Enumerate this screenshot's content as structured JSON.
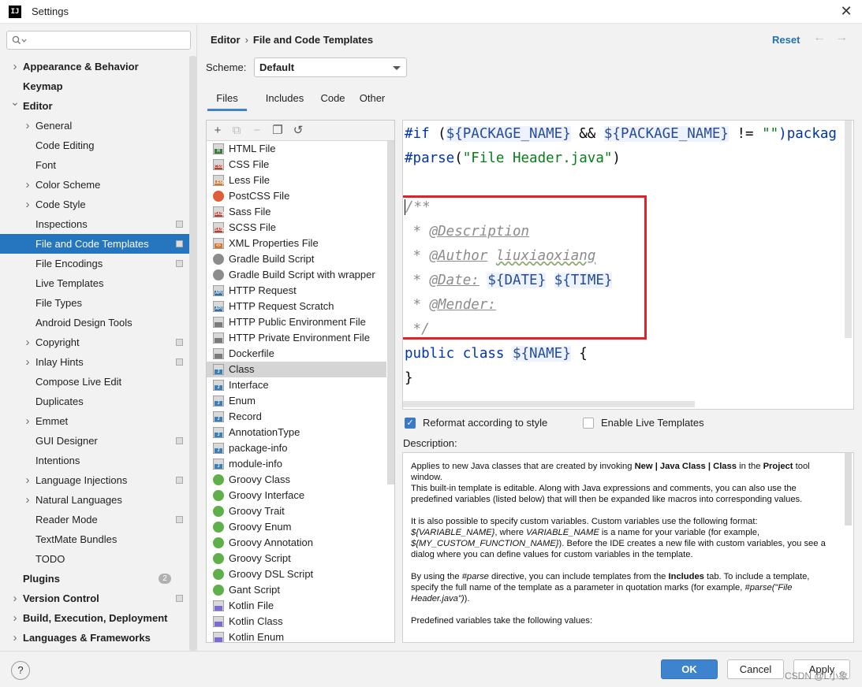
{
  "window": {
    "title": "Settings",
    "app_icon_text": "IJ",
    "close_glyph": "✕"
  },
  "sidebar": {
    "search_placeholder": "",
    "items": [
      {
        "label": "Appearance & Behavior",
        "level": 0,
        "bold": true,
        "expandable": true,
        "expanded": false
      },
      {
        "label": "Keymap",
        "level": 0,
        "bold": true
      },
      {
        "label": "Editor",
        "level": 0,
        "bold": true,
        "expandable": true,
        "expanded": true
      },
      {
        "label": "General",
        "level": 1,
        "expandable": true
      },
      {
        "label": "Code Editing",
        "level": 1
      },
      {
        "label": "Font",
        "level": 1
      },
      {
        "label": "Color Scheme",
        "level": 1,
        "expandable": true
      },
      {
        "label": "Code Style",
        "level": 1,
        "expandable": true
      },
      {
        "label": "Inspections",
        "level": 1,
        "tag": true
      },
      {
        "label": "File and Code Templates",
        "level": 1,
        "selected": true,
        "tag": true
      },
      {
        "label": "File Encodings",
        "level": 1,
        "tag": true
      },
      {
        "label": "Live Templates",
        "level": 1
      },
      {
        "label": "File Types",
        "level": 1
      },
      {
        "label": "Android Design Tools",
        "level": 1
      },
      {
        "label": "Copyright",
        "level": 1,
        "expandable": true,
        "tag": true
      },
      {
        "label": "Inlay Hints",
        "level": 1,
        "expandable": true,
        "tag": true
      },
      {
        "label": "Compose Live Edit",
        "level": 1
      },
      {
        "label": "Duplicates",
        "level": 1
      },
      {
        "label": "Emmet",
        "level": 1,
        "expandable": true
      },
      {
        "label": "GUI Designer",
        "level": 1,
        "tag": true
      },
      {
        "label": "Intentions",
        "level": 1
      },
      {
        "label": "Language Injections",
        "level": 1,
        "expandable": true,
        "tag": true
      },
      {
        "label": "Natural Languages",
        "level": 1,
        "expandable": true
      },
      {
        "label": "Reader Mode",
        "level": 1,
        "tag": true
      },
      {
        "label": "TextMate Bundles",
        "level": 1
      },
      {
        "label": "TODO",
        "level": 1
      },
      {
        "label": "Plugins",
        "level": 0,
        "bold": true,
        "badge": "2"
      },
      {
        "label": "Version Control",
        "level": 0,
        "bold": true,
        "expandable": true,
        "tag": true
      },
      {
        "label": "Build, Execution, Deployment",
        "level": 0,
        "bold": true,
        "expandable": true
      },
      {
        "label": "Languages & Frameworks",
        "level": 0,
        "bold": true,
        "expandable": true
      }
    ]
  },
  "header": {
    "breadcrumb_parent": "Editor",
    "breadcrumb_separator": "›",
    "breadcrumb_current": "File and Code Templates",
    "reset_label": "Reset",
    "back_glyph": "←",
    "forward_glyph": "→"
  },
  "scheme": {
    "label": "Scheme:",
    "value": "Default"
  },
  "tabs": [
    "Files",
    "Includes",
    "Code",
    "Other"
  ],
  "toolbar": {
    "add": "+",
    "copy_template": "⧉",
    "remove": "−",
    "duplicate": "❐",
    "reset": "↺"
  },
  "files": [
    {
      "label": "HTML File",
      "icon": "html-file-icon",
      "badge": "H",
      "color": "#3d7a3d"
    },
    {
      "label": "CSS File",
      "icon": "css-file-icon",
      "badge": "CSS",
      "color": "#c0392b"
    },
    {
      "label": "Less File",
      "icon": "less-file-icon",
      "badge": "LESS",
      "color": "#d6762c"
    },
    {
      "label": "PostCSS File",
      "icon": "postcss-file-icon",
      "circle": true,
      "color": "#e05d3a"
    },
    {
      "label": "Sass File",
      "icon": "sass-file-icon",
      "badge": "SASS",
      "color": "#c0392b"
    },
    {
      "label": "SCSS File",
      "icon": "scss-file-icon",
      "badge": "SASS",
      "color": "#c0392b"
    },
    {
      "label": "XML Properties File",
      "icon": "xml-file-icon",
      "badge": "<>",
      "color": "#d6762c"
    },
    {
      "label": "Gradle Build Script",
      "icon": "gradle-icon",
      "circle": true,
      "color": "#8c8c8c"
    },
    {
      "label": "Gradle Build Script with wrapper",
      "icon": "gradle-icon",
      "circle": true,
      "color": "#8c8c8c"
    },
    {
      "label": "HTTP Request",
      "icon": "http-request-icon",
      "badge": "API",
      "color": "#2d6ea6"
    },
    {
      "label": "HTTP Request Scratch",
      "icon": "http-request-icon",
      "badge": "API",
      "color": "#2d6ea6"
    },
    {
      "label": "HTTP Public Environment File",
      "icon": "http-env-icon",
      "badge": "",
      "color": "#7a7a7a"
    },
    {
      "label": "HTTP Private Environment File",
      "icon": "http-env-icon",
      "badge": "",
      "color": "#7a7a7a"
    },
    {
      "label": "Dockerfile",
      "icon": "docker-file-icon",
      "badge": "",
      "color": "#7a7a7a"
    },
    {
      "label": "Class",
      "icon": "java-file-icon",
      "badge": "J",
      "color": "#3a7fbd",
      "selected": true
    },
    {
      "label": "Interface",
      "icon": "java-file-icon",
      "badge": "J",
      "color": "#3a7fbd"
    },
    {
      "label": "Enum",
      "icon": "java-file-icon",
      "badge": "J",
      "color": "#3a7fbd"
    },
    {
      "label": "Record",
      "icon": "java-file-icon",
      "badge": "J",
      "color": "#3a7fbd"
    },
    {
      "label": "AnnotationType",
      "icon": "java-file-icon",
      "badge": "J",
      "color": "#3a7fbd"
    },
    {
      "label": "package-info",
      "icon": "java-file-icon",
      "badge": "J",
      "color": "#3a7fbd"
    },
    {
      "label": "module-info",
      "icon": "java-file-icon",
      "badge": "J",
      "color": "#3a7fbd"
    },
    {
      "label": "Groovy Class",
      "icon": "groovy-icon",
      "circle": true,
      "color": "#5fb04a"
    },
    {
      "label": "Groovy Interface",
      "icon": "groovy-icon",
      "circle": true,
      "color": "#5fb04a"
    },
    {
      "label": "Groovy Trait",
      "icon": "groovy-icon",
      "circle": true,
      "color": "#5fb04a"
    },
    {
      "label": "Groovy Enum",
      "icon": "groovy-icon",
      "circle": true,
      "color": "#5fb04a"
    },
    {
      "label": "Groovy Annotation",
      "icon": "groovy-icon",
      "circle": true,
      "color": "#5fb04a"
    },
    {
      "label": "Groovy Script",
      "icon": "groovy-icon",
      "circle": true,
      "color": "#5fb04a"
    },
    {
      "label": "Groovy DSL Script",
      "icon": "groovy-icon",
      "circle": true,
      "color": "#5fb04a"
    },
    {
      "label": "Gant Script",
      "icon": "groovy-icon",
      "circle": true,
      "color": "#5fb04a"
    },
    {
      "label": "Kotlin File",
      "icon": "kotlin-file-icon",
      "badge": "",
      "color": "#7a6cd6"
    },
    {
      "label": "Kotlin Class",
      "icon": "kotlin-file-icon",
      "badge": "",
      "color": "#7a6cd6"
    },
    {
      "label": "Kotlin Enum",
      "icon": "kotlin-file-icon",
      "badge": "",
      "color": "#7a6cd6"
    }
  ],
  "editor": {
    "line1": {
      "kw_if": "#if",
      "t1": " (",
      "v1": "${PACKAGE_NAME}",
      "t2": " && ",
      "v2": "${PACKAGE_NAME}",
      "t3": " != ",
      "s1": "\"\"",
      "t4": ")packag"
    },
    "line2": {
      "kw_parse": "#parse",
      "t1": "(",
      "s1": "\"File Header.java\"",
      "t2": ")"
    },
    "c1": "/**",
    "c2_star": " * ",
    "c2_tag": "@Description",
    "c3_star": " * ",
    "c3_tag": "@Author",
    "c3_val": "liuxiaoxiang",
    "c4_star": " * ",
    "c4_tag": "@Date:",
    "c4_v1": "${DATE}",
    "c4_v2": "${TIME}",
    "c5_star": " * ",
    "c5_tag": "@Mender:",
    "c6": " */",
    "decl_kw": "public class",
    "decl_v": "${NAME}",
    "decl_brace": " {",
    "close": "}"
  },
  "options": {
    "reformat_label": "Reformat according to style",
    "reformat_checked": true,
    "live_label": "Enable Live Templates",
    "live_checked": false,
    "check_glyph": "✓"
  },
  "description": {
    "label": "Description:",
    "p1_a": "Applies to new Java classes that are created by invoking ",
    "p1_b": "New | Java Class | Class",
    "p1_c": " in the ",
    "p1_d": "Project",
    "p1_e": " tool window.",
    "p1_f": "This built-in template is editable. Along with Java expressions and comments, you can also use the predefined variables (listed below) that will then be expanded like macros into corresponding values.",
    "p2_a": "It is also possible to specify custom variables. Custom variables use the following format: ",
    "p2_b": "${VARIABLE_NAME}",
    "p2_c": ", where ",
    "p2_d": "VARIABLE_NAME",
    "p2_e": " is a name for your variable (for example, ",
    "p2_f": "${MY_CUSTOM_FUNCTION_NAME}",
    "p2_g": "). Before the IDE creates a new file with custom variables, you see a dialog where you can define values for custom variables in the template.",
    "p3_a": "By using the ",
    "p3_b": "#parse",
    "p3_c": " directive, you can include templates from the ",
    "p3_d": "Includes",
    "p3_e": " tab. To include a template, specify the full name of the template as a parameter in quotation marks (for example, ",
    "p3_f": "#parse(\"File Header.java\")",
    "p3_g": ").",
    "p4": "Predefined variables take the following values:"
  },
  "footer": {
    "help": "?",
    "ok": "OK",
    "cancel": "Cancel",
    "apply": "Apply",
    "watermark": "CSDN @L小象"
  },
  "colors": {
    "accent": "#2675bf",
    "highlight_box": "#e0202a",
    "primary_button": "#3d83ce"
  }
}
